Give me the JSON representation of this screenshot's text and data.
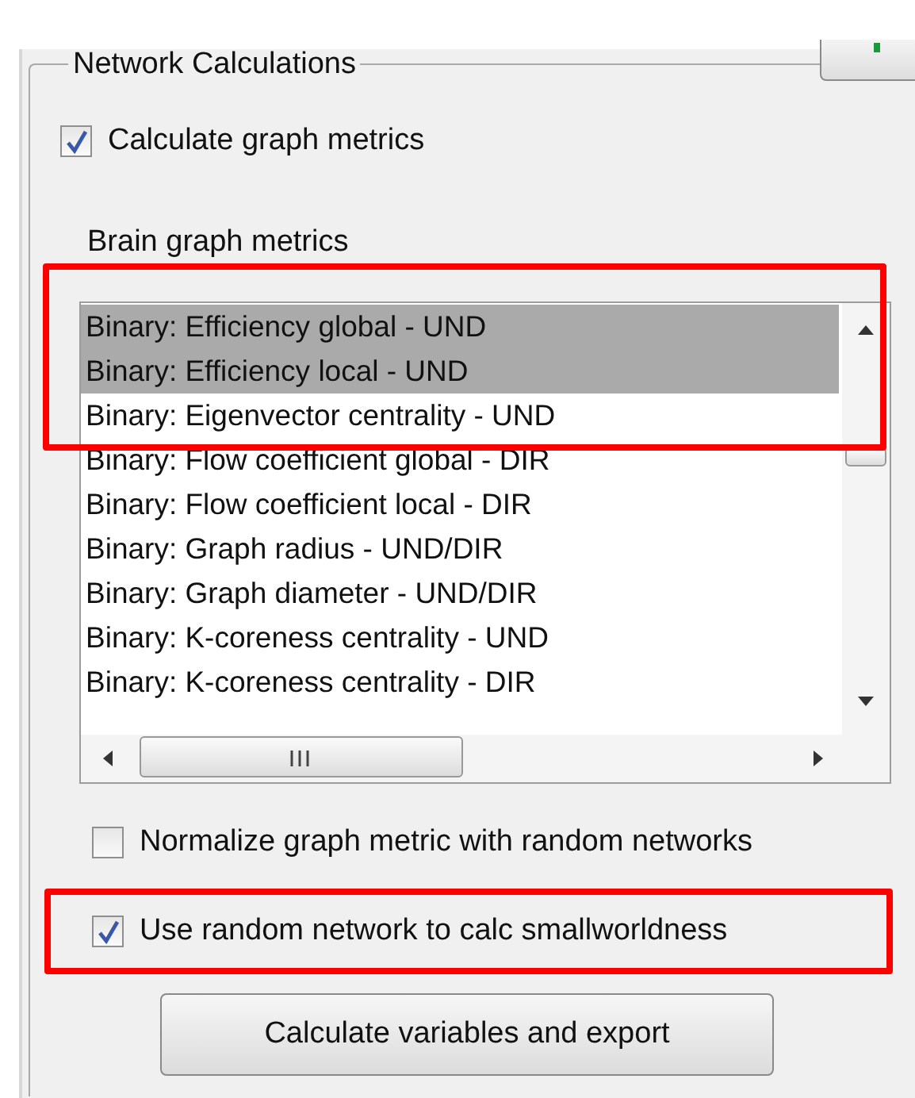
{
  "group": {
    "title": "Network Calculations"
  },
  "calculate_metrics": {
    "label": "Calculate graph metrics",
    "checked": true
  },
  "metrics_list": {
    "label": "Brain graph metrics",
    "highlighted": true,
    "items": [
      {
        "text": "Binary: Efficiency global - UND",
        "selected": true
      },
      {
        "text": "Binary: Efficiency local - UND",
        "selected": true
      },
      {
        "text": "Binary: Eigenvector centrality - UND",
        "selected": false
      },
      {
        "text": "Binary: Flow coefficient global - DIR",
        "selected": false
      },
      {
        "text": "Binary: Flow coefficient local - DIR",
        "selected": false
      },
      {
        "text": "Binary: Graph radius - UND/DIR",
        "selected": false
      },
      {
        "text": "Binary: Graph diameter - UND/DIR",
        "selected": false
      },
      {
        "text": "Binary: K-coreness centrality - UND",
        "selected": false
      },
      {
        "text": "Binary: K-coreness centrality - DIR",
        "selected": false
      }
    ]
  },
  "options": [
    {
      "label": "Normalize graph metric with random networks",
      "checked": false,
      "highlighted": false
    },
    {
      "label": "Use random network to calc smallworldness",
      "checked": true,
      "highlighted": true
    }
  ],
  "button": {
    "label": "Calculate variables and export"
  }
}
